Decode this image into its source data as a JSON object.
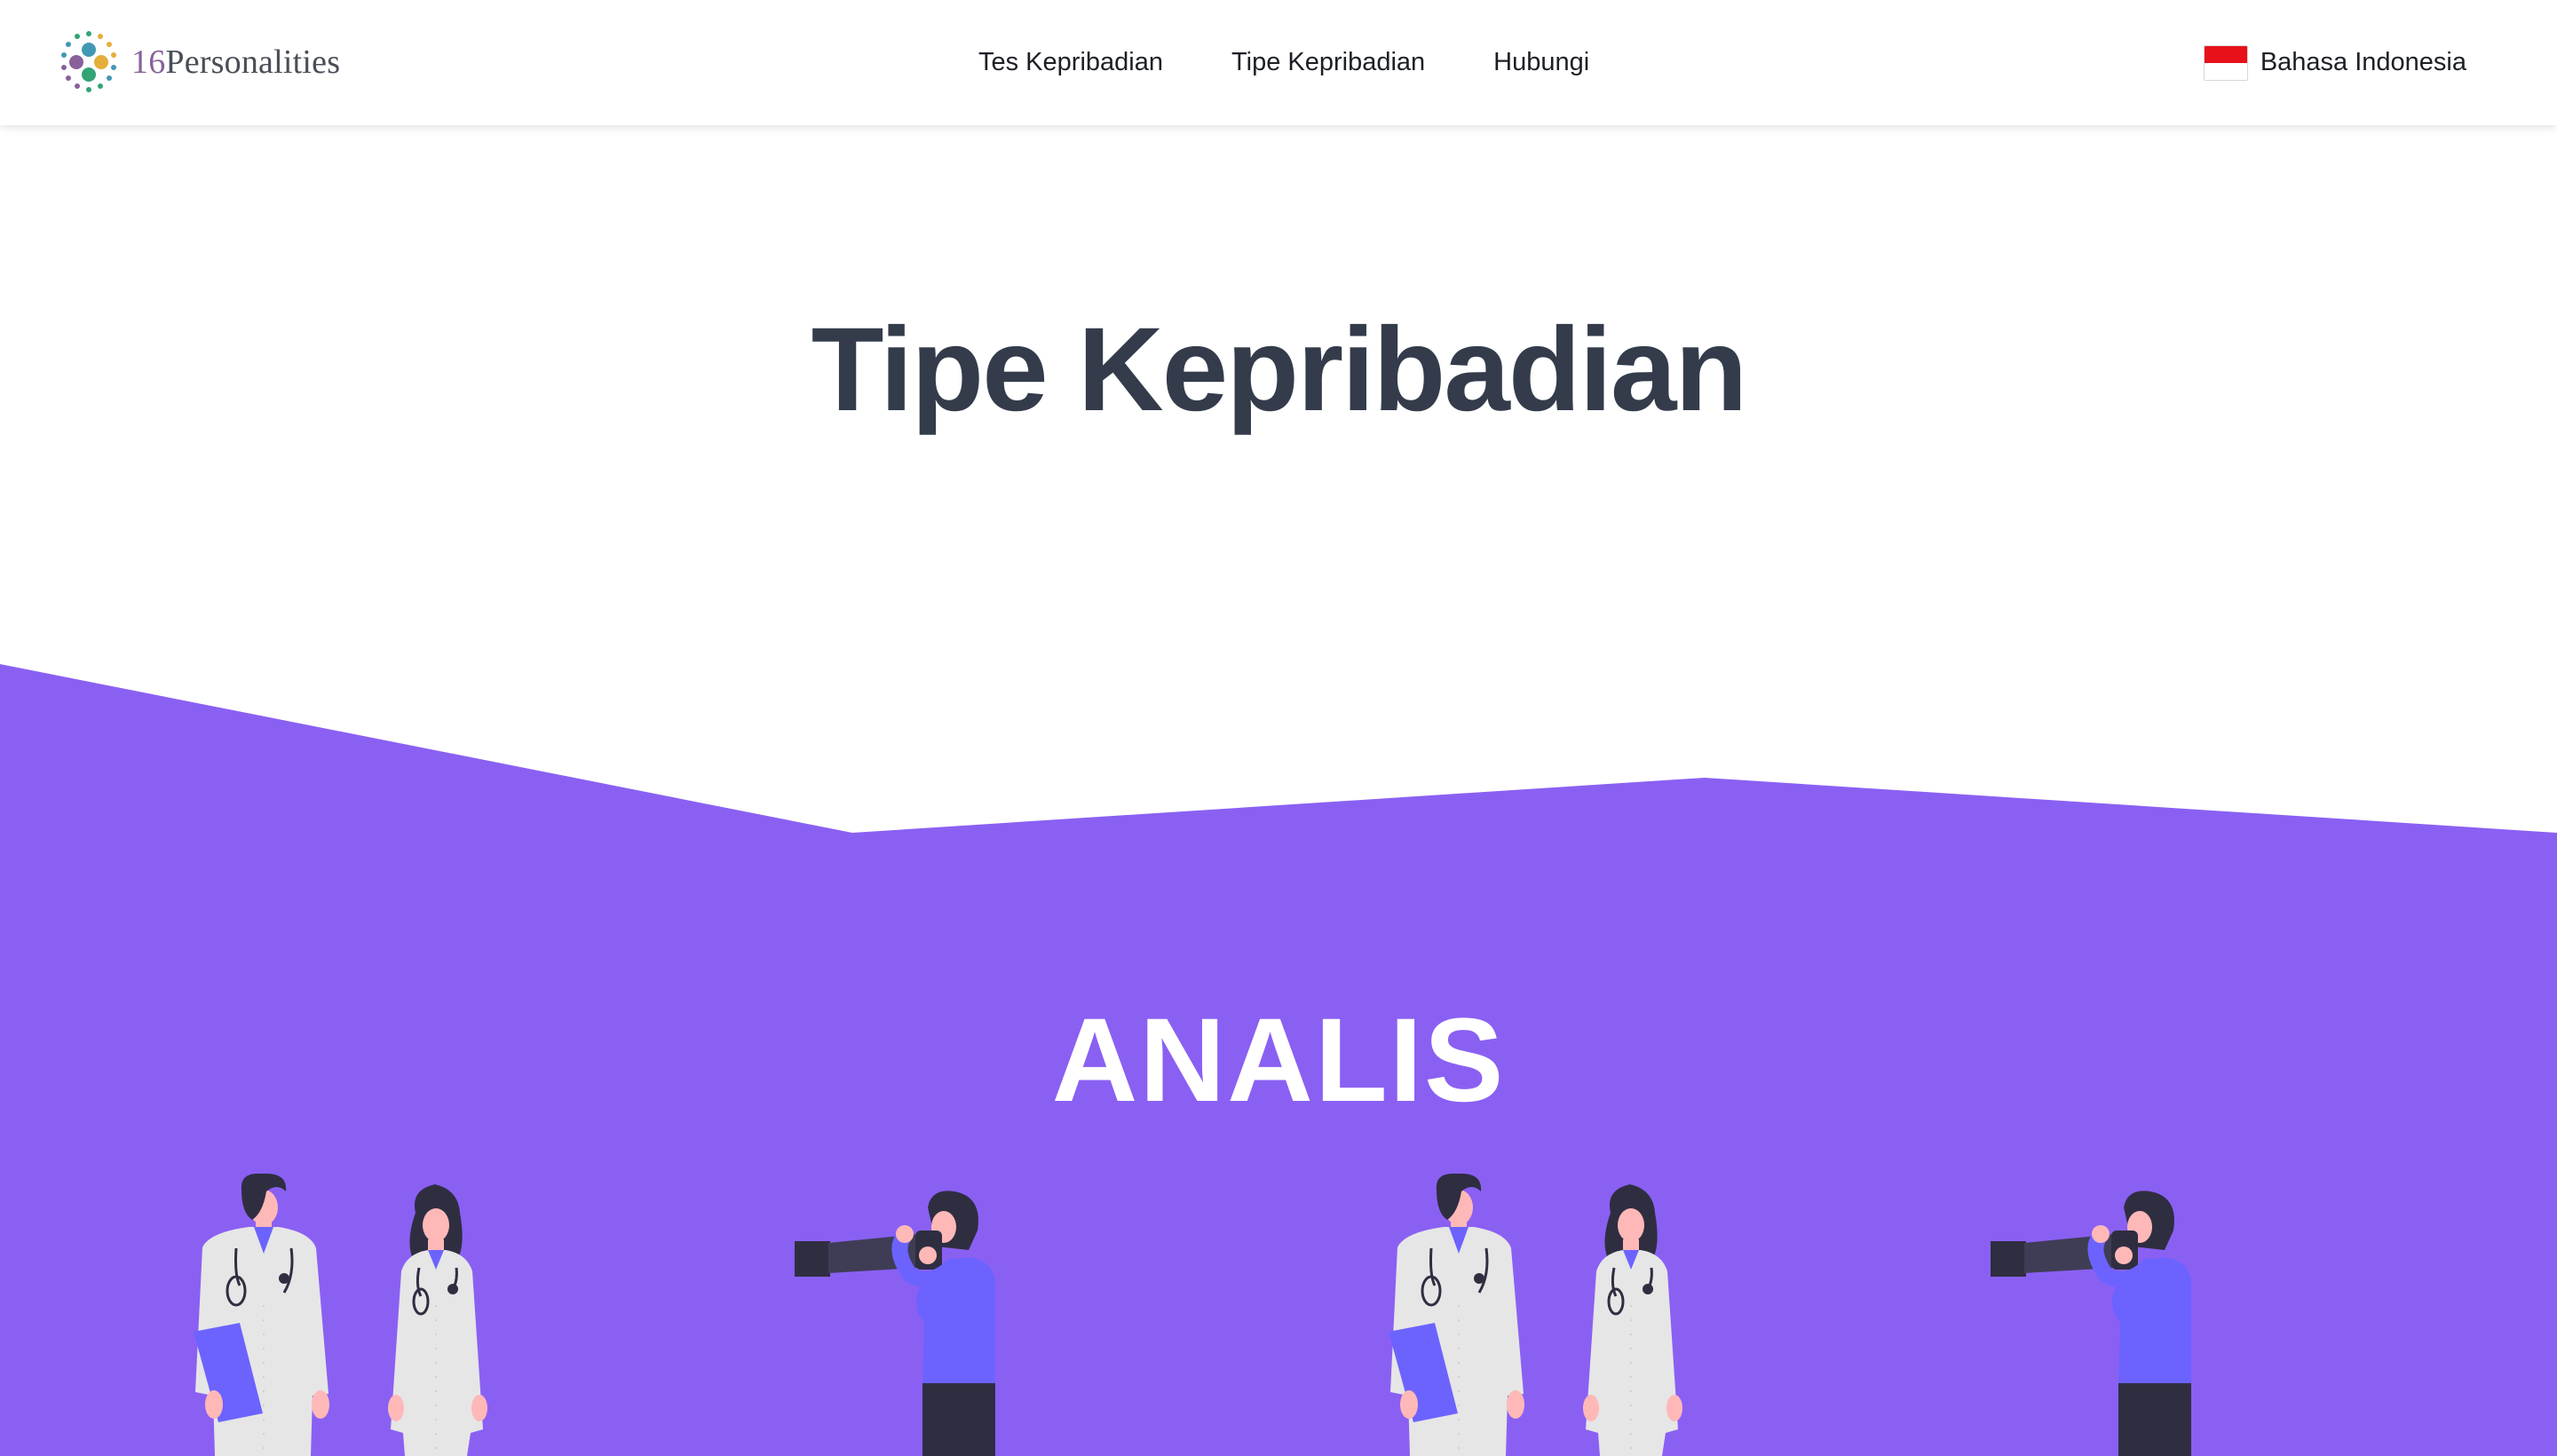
{
  "header": {
    "logo": {
      "number": "16",
      "name": "Personalities"
    },
    "nav": [
      {
        "label": "Tes Kepribadian"
      },
      {
        "label": "Tipe Kepribadian"
      },
      {
        "label": "Hubungi"
      }
    ],
    "language": {
      "label": "Bahasa Indonesia",
      "flag": "indonesia-flag-icon"
    }
  },
  "hero": {
    "title": "Tipe Kepribadian"
  },
  "section": {
    "title": "ANALIS"
  },
  "colors": {
    "accent_purple": "#8a60f3",
    "title_text": "#343c4b",
    "header_bg": "#ffffff",
    "illustration_blue": "#6c63ff",
    "illustration_dark": "#2f2e41"
  },
  "illustrations": [
    "doctors-illustration",
    "photographer-illustration",
    "doctors-illustration",
    "photographer-illustration"
  ]
}
